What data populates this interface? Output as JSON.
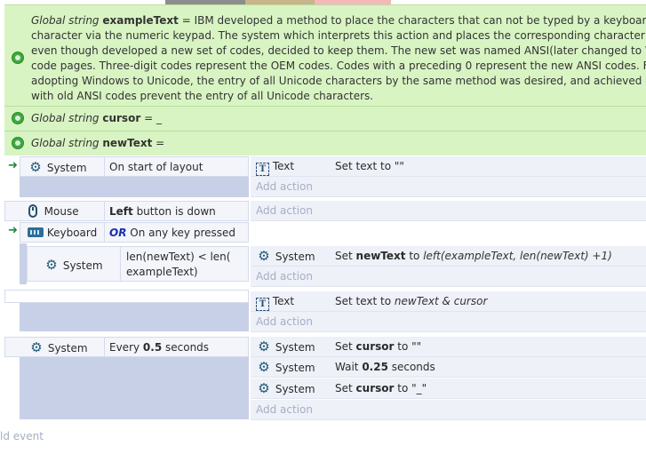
{
  "colors": {
    "global_bg": "#d8f4c3",
    "event_band": "#c7d0e6",
    "cell_bg": "#f3f5fb",
    "or_color": "#1c2fb0",
    "arrow_color": "#1f8a3a"
  },
  "globals": [
    {
      "prefix": "Global string ",
      "name": "exampleText",
      "eq": " = ",
      "lines": [
        "IBM developed a method to place the characters that can not be typed by a keyboard on th",
        "character via the numeric keypad. The system which interprets this action and places the corresponding character at the c",
        "even though developed a new set of codes, decided to keep them. The new set was named ANSI(later changed to Windo",
        "code pages. Three-digit codes represent the OEM codes. Codes with a preceding 0 represent the new ANSI codes. For the",
        "adopting Windows to Unicode, the entry of all Unicode characters by the same method was desired, and achieved by son",
        "with old ANSI codes prevent the entry of all Unicode characters."
      ]
    },
    {
      "prefix": "Global string ",
      "name": "cursor",
      "eq": " = ",
      "value": "_"
    },
    {
      "prefix": "Global string ",
      "name": "newText",
      "eq": " = ",
      "value": ""
    }
  ],
  "events": {
    "e1": {
      "object": "System",
      "condition": "On start of layout",
      "action_object": "Text",
      "action_text": "Set text to \"\"",
      "add_action": "Add action"
    },
    "e2": {
      "c1_object": "Mouse",
      "c1_bold": "Left",
      "c1_rest": " button is down",
      "c2_object": "Keyboard",
      "c2_or": "OR",
      "c2_rest": " On any key pressed",
      "add_action": "Add action"
    },
    "e3": {
      "object": "System",
      "condition_line1": "len(newText) < len(",
      "condition_line2": "exampleText)",
      "action_object": "System",
      "action_pre": "Set ",
      "action_bold": "newText",
      "action_mid": " to ",
      "action_italic": "left(exampleText, len(newText) +1)",
      "add_action": "Add action"
    },
    "e4": {
      "action_object": "Text",
      "action_pre": "Set text to ",
      "action_italic": "newText & cursor",
      "add_action": "Add action"
    },
    "e5": {
      "object": "System",
      "cond_pre": "Every ",
      "cond_bold": "0.5",
      "cond_post": " seconds",
      "a1_object": "System",
      "a1_pre": "Set ",
      "a1_bold": "cursor",
      "a1_post": " to \"\"",
      "a2_object": "System",
      "a2_pre": "Wait ",
      "a2_bold": "0.25",
      "a2_post": " seconds",
      "a3_object": "System",
      "a3_pre": "Set ",
      "a3_bold": "cursor",
      "a3_post": " to \"_\"",
      "add_action": "Add action"
    }
  },
  "add_event_label": "ld event"
}
